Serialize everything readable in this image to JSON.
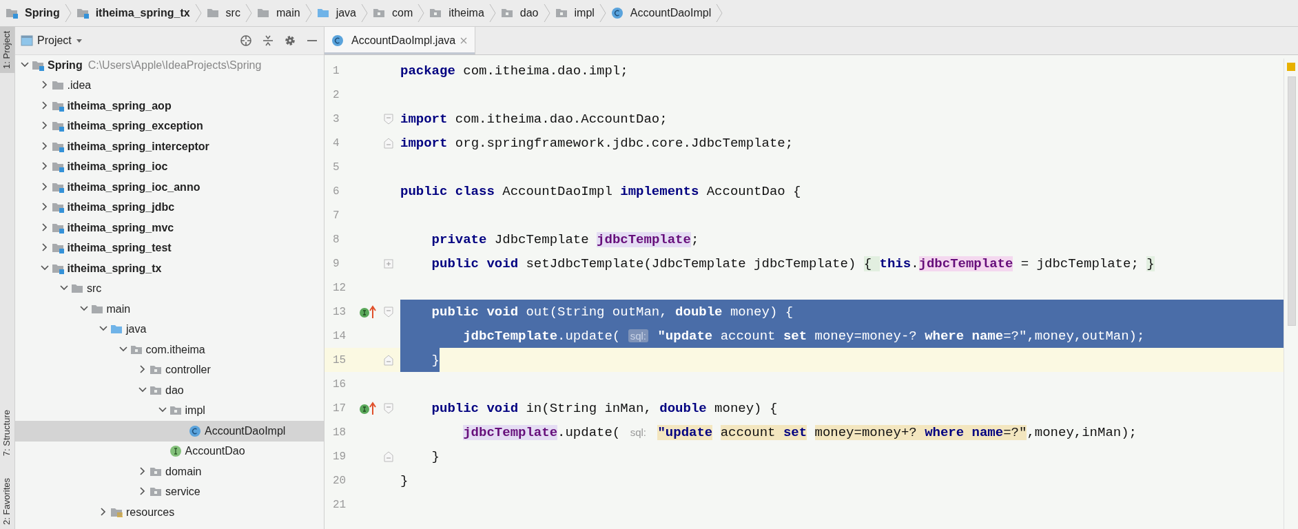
{
  "breadcrumbs": [
    {
      "label": "Spring",
      "kind": "module"
    },
    {
      "label": "itheima_spring_tx",
      "kind": "module"
    },
    {
      "label": "src",
      "kind": "folder"
    },
    {
      "label": "main",
      "kind": "folder"
    },
    {
      "label": "java",
      "kind": "source"
    },
    {
      "label": "com",
      "kind": "package"
    },
    {
      "label": "itheima",
      "kind": "package"
    },
    {
      "label": "dao",
      "kind": "package"
    },
    {
      "label": "impl",
      "kind": "package"
    },
    {
      "label": "AccountDaoImpl",
      "kind": "class"
    }
  ],
  "tool_stripe": [
    {
      "label": "1: Project",
      "selected": true
    },
    {
      "label": "7: Structure",
      "selected": false
    },
    {
      "label": "2: Favorites",
      "selected": false
    }
  ],
  "project_panel": {
    "title": "Project",
    "tree": [
      {
        "label": "Spring",
        "path": "C:\\Users\\Apple\\IdeaProjects\\Spring",
        "kind": "module",
        "expanded": true,
        "selected": false,
        "children": [
          {
            "label": ".idea",
            "kind": "folder",
            "expanded": false,
            "selected": false
          },
          {
            "label": "itheima_spring_aop",
            "kind": "module",
            "expanded": false,
            "selected": false
          },
          {
            "label": "itheima_spring_exception",
            "kind": "module",
            "expanded": false,
            "selected": false
          },
          {
            "label": "itheima_spring_interceptor",
            "kind": "module",
            "expanded": false,
            "selected": false
          },
          {
            "label": "itheima_spring_ioc",
            "kind": "module",
            "expanded": false,
            "selected": false
          },
          {
            "label": "itheima_spring_ioc_anno",
            "kind": "module",
            "expanded": false,
            "selected": false
          },
          {
            "label": "itheima_spring_jdbc",
            "kind": "module",
            "expanded": false,
            "selected": false
          },
          {
            "label": "itheima_spring_mvc",
            "kind": "module",
            "expanded": false,
            "selected": false
          },
          {
            "label": "itheima_spring_test",
            "kind": "module",
            "expanded": false,
            "selected": false
          },
          {
            "label": "itheima_spring_tx",
            "kind": "module",
            "expanded": true,
            "selected": false,
            "children": [
              {
                "label": "src",
                "kind": "folder",
                "expanded": true,
                "selected": false,
                "children": [
                  {
                    "label": "main",
                    "kind": "folder",
                    "expanded": true,
                    "selected": false,
                    "children": [
                      {
                        "label": "java",
                        "kind": "source",
                        "expanded": true,
                        "selected": false,
                        "children": [
                          {
                            "label": "com.itheima",
                            "kind": "package",
                            "expanded": true,
                            "selected": false,
                            "children": [
                              {
                                "label": "controller",
                                "kind": "package",
                                "expanded": false,
                                "selected": false
                              },
                              {
                                "label": "dao",
                                "kind": "package",
                                "expanded": true,
                                "selected": false,
                                "children": [
                                  {
                                    "label": "impl",
                                    "kind": "package",
                                    "expanded": true,
                                    "selected": false,
                                    "children": [
                                      {
                                        "label": "AccountDaoImpl",
                                        "kind": "class",
                                        "selected": true
                                      }
                                    ]
                                  },
                                  {
                                    "label": "AccountDao",
                                    "kind": "interface",
                                    "selected": false
                                  }
                                ]
                              },
                              {
                                "label": "domain",
                                "kind": "package",
                                "expanded": false,
                                "selected": false
                              },
                              {
                                "label": "service",
                                "kind": "package",
                                "expanded": false,
                                "selected": false
                              }
                            ]
                          }
                        ]
                      },
                      {
                        "label": "resources",
                        "kind": "resources",
                        "expanded": false,
                        "selected": false
                      }
                    ]
                  }
                ]
              }
            ]
          }
        ]
      }
    ]
  },
  "editor": {
    "tabs": [
      {
        "label": "AccountDaoImpl.java",
        "selected": true
      }
    ],
    "lines": [
      {
        "number": "1",
        "selected": false,
        "caret": false,
        "marker": false,
        "tokens": [
          {
            "kind": "kw",
            "text": "package"
          },
          {
            "kind": "plain",
            "text": " com.itheima.dao.impl;"
          }
        ]
      },
      {
        "number": "2",
        "selected": false,
        "caret": false,
        "marker": false
      },
      {
        "number": "3",
        "selected": false,
        "caret": false,
        "marker": false,
        "fold_marker": {
          "kind": "open"
        },
        "tokens": [
          {
            "kind": "kw",
            "text": "import"
          },
          {
            "kind": "plain",
            "text": " com.itheima.dao.AccountDao;"
          }
        ]
      },
      {
        "number": "4",
        "selected": false,
        "caret": false,
        "marker": false,
        "fold_marker": {
          "kind": "close"
        },
        "tokens": [
          {
            "kind": "kw",
            "text": "import"
          },
          {
            "kind": "plain",
            "text": " org.springframework.jdbc.core.JdbcTemplate;"
          }
        ]
      },
      {
        "number": "5",
        "selected": false,
        "caret": false,
        "marker": false
      },
      {
        "number": "6",
        "selected": false,
        "caret": false,
        "marker": false,
        "tokens": [
          {
            "kind": "kw",
            "text": "public class"
          },
          {
            "kind": "plain",
            "text": " AccountDaoImpl "
          },
          {
            "kind": "kw",
            "text": "implements"
          },
          {
            "kind": "plain",
            "text": " AccountDao {"
          }
        ]
      },
      {
        "number": "7",
        "selected": false,
        "caret": false,
        "marker": false
      },
      {
        "number": "8",
        "selected": false,
        "caret": false,
        "marker": false,
        "tokens": [
          {
            "kind": "kw",
            "text": "    private"
          },
          {
            "kind": "plain",
            "text": " JdbcTemplate "
          },
          {
            "kind": "field-read",
            "text": "jdbcTemplate"
          },
          {
            "kind": "plain",
            "text": ";"
          }
        ]
      },
      {
        "number": "9",
        "selected": false,
        "caret": false,
        "marker": false,
        "fold_marker": {
          "kind": "folded"
        },
        "tokens": [
          {
            "kind": "kw",
            "text": "    public void"
          },
          {
            "kind": "plain",
            "text": " setJdbcTemplate(JdbcTemplate jdbcTemplate) "
          },
          {
            "kind": "fold-brace",
            "text": "{ "
          },
          {
            "kind": "kw",
            "text": "this"
          },
          {
            "kind": "plain",
            "text": "."
          },
          {
            "kind": "field-write",
            "text": "jdbcTemplate"
          },
          {
            "kind": "plain",
            "text": " = jdbcTemplate; "
          },
          {
            "kind": "fold-brace",
            "text": "}"
          }
        ]
      },
      {
        "number": "12",
        "selected": false,
        "caret": false,
        "marker": false
      },
      {
        "number": "13",
        "selected": true,
        "caret": false,
        "marker": true,
        "fold_marker": {
          "kind": "open"
        },
        "tokens": [
          {
            "kind": "kw",
            "text": "    public void"
          },
          {
            "kind": "plain",
            "text": " out(String outMan, "
          },
          {
            "kind": "kw",
            "text": "double"
          },
          {
            "kind": "plain",
            "text": " money) {"
          }
        ]
      },
      {
        "number": "14",
        "selected": true,
        "caret": false,
        "marker": false,
        "tokens": [
          {
            "kind": "field",
            "text": "        jdbcTemplate"
          },
          {
            "kind": "plain",
            "text": ".update( "
          },
          {
            "kind": "hint",
            "text": "sql:"
          },
          {
            "kind": "sqlkw",
            "text": " \"update"
          },
          {
            "kind": "sql",
            "text": " account "
          },
          {
            "kind": "sqlkw",
            "text": "set"
          },
          {
            "kind": "sql",
            "text": " money=money-? "
          },
          {
            "kind": "sqlkw",
            "text": "where name"
          },
          {
            "kind": "sql",
            "text": "=?\""
          },
          {
            "kind": "plain",
            "text": ",money,outMan);"
          }
        ]
      },
      {
        "number": "15",
        "selected": true,
        "caret": true,
        "marker": false,
        "fold_marker": {
          "kind": "close"
        },
        "tokens": [
          {
            "kind": "plain",
            "text": "    }"
          }
        ]
      },
      {
        "number": "16",
        "selected": false,
        "caret": false,
        "marker": false
      },
      {
        "number": "17",
        "selected": false,
        "caret": false,
        "marker": true,
        "fold_marker": {
          "kind": "open"
        },
        "tokens": [
          {
            "kind": "kw",
            "text": "    public void"
          },
          {
            "kind": "plain",
            "text": " in(String inMan, "
          },
          {
            "kind": "kw",
            "text": "double"
          },
          {
            "kind": "plain",
            "text": " money) {"
          }
        ]
      },
      {
        "number": "18",
        "selected": false,
        "caret": false,
        "marker": false,
        "injected": true,
        "tokens": [
          {
            "kind": "field-read",
            "text": "        jdbcTemplate"
          },
          {
            "kind": "plain",
            "text": ".update( "
          },
          {
            "kind": "hint",
            "text": "sql:"
          },
          {
            "kind": "sqlkw",
            "text": " \"update"
          },
          {
            "kind": "sql",
            "text": " account "
          },
          {
            "kind": "sqlkw",
            "text": "set"
          },
          {
            "kind": "sql",
            "text": " money=money+? "
          },
          {
            "kind": "sqlkw",
            "text": "where name"
          },
          {
            "kind": "sql",
            "text": "=?\""
          },
          {
            "kind": "plain",
            "text": ",money,inMan);"
          }
        ]
      },
      {
        "number": "19",
        "selected": false,
        "caret": false,
        "marker": false,
        "fold_marker": {
          "kind": "close"
        },
        "tokens": [
          {
            "kind": "plain",
            "text": "    }"
          }
        ]
      },
      {
        "number": "20",
        "selected": false,
        "caret": false,
        "marker": false,
        "tokens": [
          {
            "kind": "plain",
            "text": "}"
          }
        ]
      },
      {
        "number": "21",
        "selected": false,
        "caret": false,
        "marker": false
      }
    ]
  }
}
